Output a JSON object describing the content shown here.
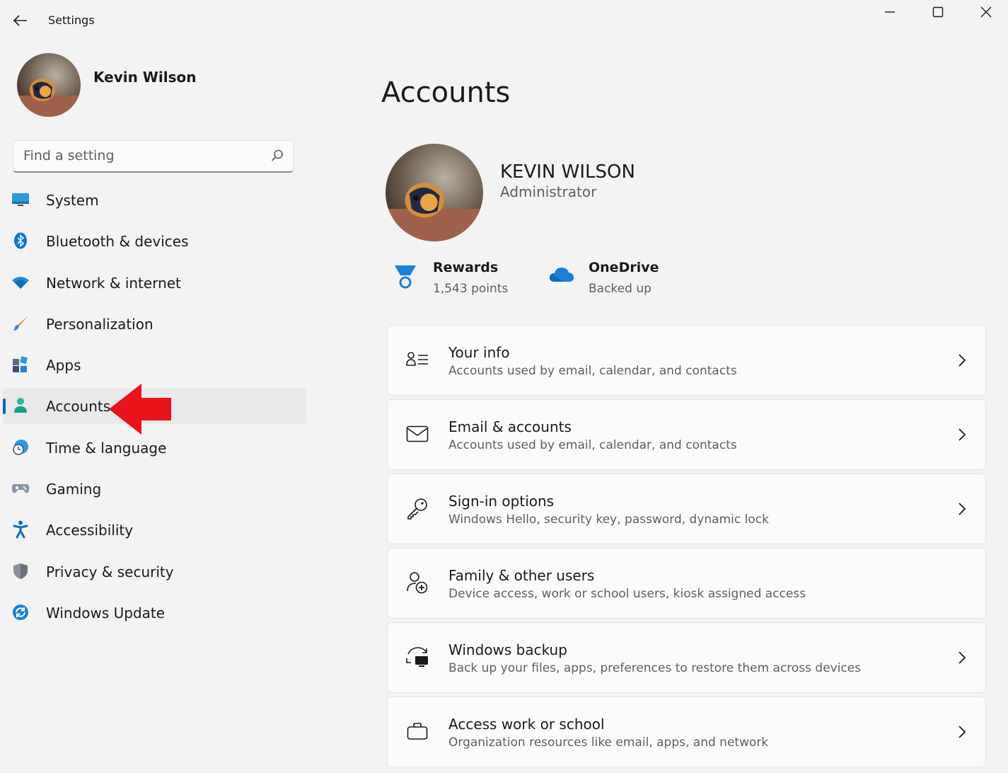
{
  "titlebar": {
    "title": "Settings"
  },
  "sidebar": {
    "user_name": "Kevin Wilson",
    "search_placeholder": "Find a setting",
    "items": [
      {
        "label": "System",
        "icon": "system-icon"
      },
      {
        "label": "Bluetooth & devices",
        "icon": "bluetooth-icon"
      },
      {
        "label": "Network & internet",
        "icon": "wifi-icon"
      },
      {
        "label": "Personalization",
        "icon": "brush-icon"
      },
      {
        "label": "Apps",
        "icon": "apps-icon"
      },
      {
        "label": "Accounts",
        "icon": "accounts-icon",
        "selected": true
      },
      {
        "label": "Time & language",
        "icon": "time-language-icon"
      },
      {
        "label": "Gaming",
        "icon": "gamepad-icon"
      },
      {
        "label": "Accessibility",
        "icon": "accessibility-icon"
      },
      {
        "label": "Privacy & security",
        "icon": "shield-icon"
      },
      {
        "label": "Windows Update",
        "icon": "update-icon"
      }
    ]
  },
  "main": {
    "title": "Accounts",
    "profile": {
      "name": "KEVIN WILSON",
      "role": "Administrator"
    },
    "rewards": {
      "title": "Rewards",
      "subtitle": "1,543 points"
    },
    "onedrive": {
      "title": "OneDrive",
      "subtitle": "Backed up"
    },
    "cards": [
      {
        "title": "Your info",
        "subtitle": "Accounts used by email, calendar, and contacts",
        "icon": "person-list-icon"
      },
      {
        "title": "Email & accounts",
        "subtitle": "Accounts used by email, calendar, and contacts",
        "icon": "mail-icon"
      },
      {
        "title": "Sign-in options",
        "subtitle": "Windows Hello, security key, password, dynamic lock",
        "icon": "key-icon"
      },
      {
        "title": "Family & other users",
        "subtitle": "Device access, work or school users, kiosk assigned access",
        "icon": "add-person-icon"
      },
      {
        "title": "Windows backup",
        "subtitle": "Back up your files, apps, preferences to restore them across devices",
        "icon": "backup-icon"
      },
      {
        "title": "Access work or school",
        "subtitle": "Organization resources like email, apps, and network",
        "icon": "briefcase-icon"
      }
    ]
  },
  "colors": {
    "accent": "#0067c0",
    "annotation_arrow": "#e8131b"
  }
}
